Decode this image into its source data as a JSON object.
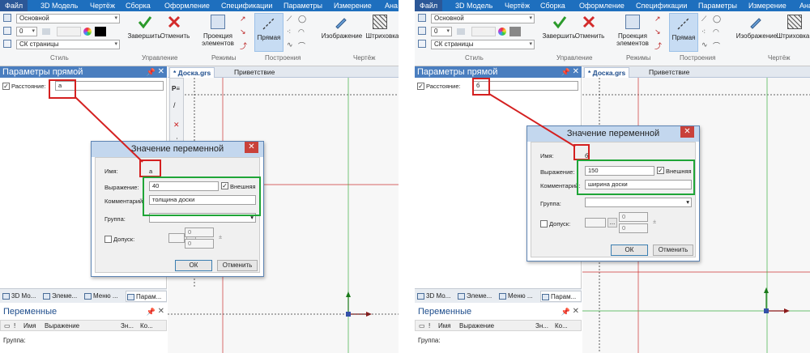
{
  "menu": [
    "Файл",
    "3D Модель",
    "Чертёж",
    "Сборка",
    "Оформление",
    "Спецификации",
    "Параметры",
    "Измерение",
    "Ана"
  ],
  "style_group": {
    "layer": "Основной",
    "width": "0",
    "cs": "СК страницы",
    "label": "Стиль"
  },
  "control_group": {
    "finish": "Завершить",
    "cancel": "Отменить",
    "label": "Управление"
  },
  "modes_group": {
    "projection": "Проекция элементов",
    "label": "Режимы"
  },
  "build_group": {
    "line": "Прямая",
    "label": "Построения"
  },
  "drawing_group": {
    "image": "Изображение",
    "hatch": "Штриховка",
    "label": "Чертёж"
  },
  "param_panel": {
    "title": "Параметры прямой",
    "distance_label": "Расстояние:"
  },
  "doc_tabs": {
    "doc": "* Доска.grs",
    "welcome": "Приветствие"
  },
  "bottom_tabs": [
    "3D Мо...",
    "Элеме...",
    "Меню ...",
    "Парам..."
  ],
  "bottom_tabs_right": [
    "3D Мо...",
    "Элеме...",
    "Меню ...",
    "Парам..."
  ],
  "variables": {
    "title": "Переменные",
    "col_name": "Имя",
    "col_expr": "Выражение",
    "col_val": "Зн...",
    "col_comment": "Ко...",
    "group_row": "Группа:"
  },
  "dialog_common": {
    "title": "Значение переменной",
    "name_label": "Имя:",
    "expr_label": "Выражение:",
    "external": "Внешняя",
    "comment_label": "Комментарий:",
    "group_label": "Группа:",
    "tolerance": "Допуск:",
    "ellipsis": "...",
    "zero": "0",
    "pm": "±",
    "ok": "ОК",
    "cancel": "Отменить"
  },
  "left": {
    "distance_value": "a",
    "name": "a",
    "expr": "40",
    "comment": "толщина доски"
  },
  "right": {
    "distance_value": "б",
    "name": "б",
    "expr": "150",
    "comment": "ширина доски"
  },
  "icons": {
    "pin": "pin-icon",
    "close": "close-icon",
    "dropdown": "chevron-down-icon"
  }
}
